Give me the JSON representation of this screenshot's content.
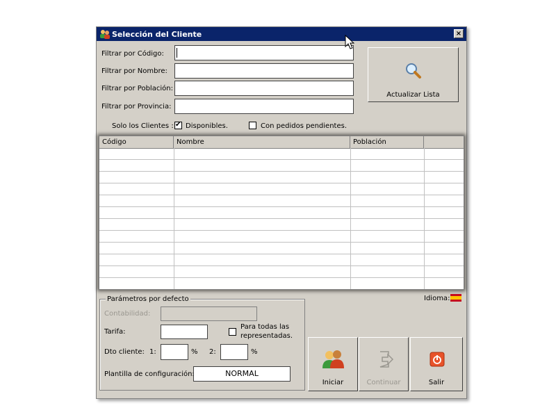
{
  "window": {
    "title": "Selección del Cliente",
    "close_glyph": "×"
  },
  "filters": [
    {
      "label": "Filtrar por Código:",
      "value": ""
    },
    {
      "label": "Filtrar por Nombre:",
      "value": ""
    },
    {
      "label": "Filtrar por Población:",
      "value": ""
    },
    {
      "label": "Filtrar por Provincia:",
      "value": ""
    }
  ],
  "refresh_button": {
    "label": "Actualizar Lista",
    "icon": "magnifier-icon"
  },
  "solo_clientes": {
    "label": "Solo los Clientes :",
    "disponibles": {
      "label": "Disponibles.",
      "checked": true,
      "mark": "✔"
    },
    "pendientes": {
      "label": "Con pedidos pendientes.",
      "checked": false
    }
  },
  "table": {
    "columns": [
      "Código",
      "Nombre",
      "Población",
      ""
    ],
    "rows": []
  },
  "idioma": {
    "label": "Idioma:",
    "flag": "spain-flag-icon"
  },
  "params": {
    "title": "Parámetros por defecto",
    "contabilidad": {
      "label": "Contabilidad:",
      "value": ""
    },
    "tarifa": {
      "label": "Tarifa:",
      "value": ""
    },
    "todas": {
      "label_line1": "Para todas las",
      "label_line2": "representadas.",
      "checked": false
    },
    "dto": {
      "label": "Dto cliente:",
      "one": "1:",
      "two": "2:",
      "pct": "%",
      "value1": "",
      "value2": ""
    },
    "plantilla": {
      "label": "Plantilla de configuración:",
      "value": "NORMAL"
    }
  },
  "actions": {
    "iniciar": {
      "label": "Iniciar",
      "icon": "users-icon"
    },
    "continuar": {
      "label": "Continuar",
      "icon": "continue-arrow-icon",
      "disabled": true
    },
    "salir": {
      "label": "Salir",
      "icon": "power-icon"
    }
  },
  "colors": {
    "titlebar": "#0a246a",
    "face": "#d4d0c8",
    "salir": "#e8532a"
  }
}
